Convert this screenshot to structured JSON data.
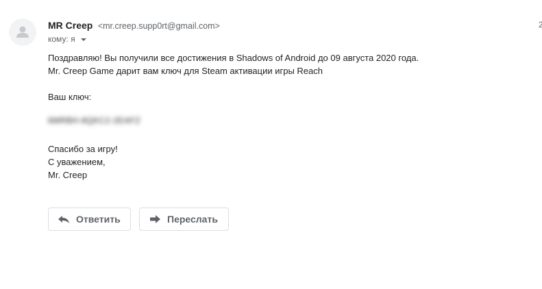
{
  "message": {
    "sender": {
      "name": "MR Creep",
      "email": "<mr.creep.supp0rt@gmail.com>"
    },
    "recipient_label": "кому: я",
    "edge_text": "2",
    "body": {
      "line1": "Поздравляю! Вы получили все достижения в Shadows of Android до 09 августа 2020 года.",
      "line2": "Mr. Creep Game дарит вам ключ для Steam активации игры Reach",
      "key_label": "Ваш ключ:",
      "key_value_blurred": "6MRBH-8QKC2-2EAFZ",
      "thanks": "Спасибо за игру!",
      "regards": "С уважением,",
      "signature": "Mr. Creep"
    }
  },
  "actions": {
    "reply_label": "Ответить",
    "forward_label": "Переслать"
  },
  "icons": {
    "avatar": "default-avatar-icon",
    "recipient_caret": "caret-down-icon",
    "reply": "reply-icon",
    "forward": "forward-icon"
  },
  "colors": {
    "text": "#222222",
    "secondary_text": "#5f6368",
    "button_border": "#dadce0",
    "avatar_bg": "#f1f3f4",
    "avatar_fg": "#c7cacd"
  }
}
